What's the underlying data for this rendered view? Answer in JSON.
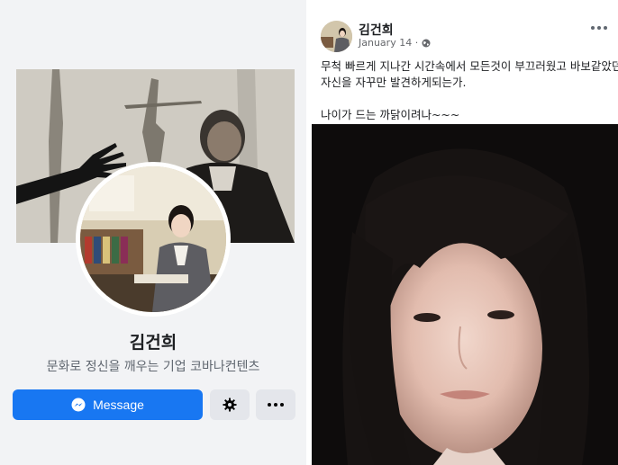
{
  "profile": {
    "name": "김건희",
    "tagline": "문화로 정신을 깨우는 기업  코바나컨텐츠",
    "message_label": "Message",
    "icons": {
      "message": "messenger-icon",
      "settings": "gear-icon",
      "more": "more-dots-icon"
    }
  },
  "post": {
    "author": "김건희",
    "date": "January 14 · ",
    "privacy_icon": "globe-icon",
    "more_icon": "more-dots-icon",
    "lines": [
      "무척 빠르게 지나간 시간속에서 모든것이 부끄러웠고 바보같았던",
      "자신을 자꾸만 발견하게되는가.",
      "나이가 드는 까닭이려나~~~"
    ]
  },
  "colors": {
    "accent": "#1877f2",
    "panel_bg": "#f2f3f5",
    "button_gray": "#e4e6eb"
  }
}
